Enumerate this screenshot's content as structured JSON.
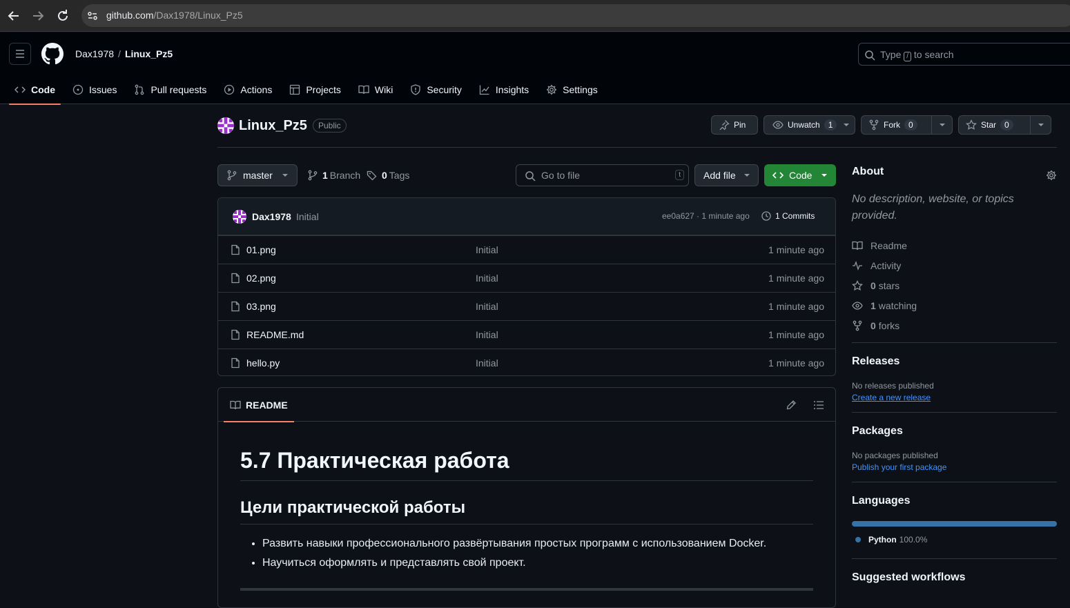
{
  "browser": {
    "url_host": "github.com",
    "url_path": "/Dax1978/Linux_Pz5"
  },
  "header": {
    "owner": "Dax1978",
    "separator": "/",
    "repo": "Linux_Pz5",
    "search_prefix": "Type",
    "search_key": "/",
    "search_suffix": "to search"
  },
  "tabs": [
    {
      "label": "Code",
      "icon": "code-icon"
    },
    {
      "label": "Issues",
      "icon": "issue-icon"
    },
    {
      "label": "Pull requests",
      "icon": "pull-request-icon"
    },
    {
      "label": "Actions",
      "icon": "play-icon"
    },
    {
      "label": "Projects",
      "icon": "table-icon"
    },
    {
      "label": "Wiki",
      "icon": "book-icon"
    },
    {
      "label": "Security",
      "icon": "shield-icon"
    },
    {
      "label": "Insights",
      "icon": "graph-icon"
    },
    {
      "label": "Settings",
      "icon": "gear-icon"
    }
  ],
  "repo": {
    "name": "Linux_Pz5",
    "visibility": "Public",
    "pin": "Pin",
    "unwatch": "Unwatch",
    "watch_count": "1",
    "fork": "Fork",
    "fork_count": "0",
    "star": "Star",
    "star_count": "0"
  },
  "toolbar": {
    "branch": "master",
    "branch_count": "1",
    "branch_label": "Branch",
    "tag_count": "0",
    "tag_label": "Tags",
    "go_to_file": "Go to file",
    "go_key": "t",
    "add_file": "Add file",
    "code": "Code"
  },
  "commit": {
    "author": "Dax1978",
    "message": "Initial",
    "hash_time": "ee0a627 · 1 minute ago",
    "commits": "1 Commits"
  },
  "files": [
    {
      "name": "01.png",
      "message": "Initial",
      "time": "1 minute ago"
    },
    {
      "name": "02.png",
      "message": "Initial",
      "time": "1 minute ago"
    },
    {
      "name": "03.png",
      "message": "Initial",
      "time": "1 minute ago"
    },
    {
      "name": "README.md",
      "message": "Initial",
      "time": "1 minute ago"
    },
    {
      "name": "hello.py",
      "message": "Initial",
      "time": "1 minute ago"
    }
  ],
  "readme": {
    "tab": "README",
    "h1": "5.7 Практическая работа",
    "h2": "Цели практической работы",
    "items": [
      "Развить навыки профессионального развёртывания простых программ с использованием Docker.",
      "Научиться оформлять и представлять свой проект."
    ]
  },
  "about": {
    "title": "About",
    "description": "No description, website, or topics provided.",
    "readme": "Readme",
    "activity": "Activity",
    "stars_count": "0",
    "stars_label": "stars",
    "watching_count": "1",
    "watching_label": "watching",
    "forks_count": "0",
    "forks_label": "forks"
  },
  "releases": {
    "title": "Releases",
    "empty": "No releases published",
    "link": "Create a new release"
  },
  "packages": {
    "title": "Packages",
    "empty": "No packages published",
    "link": "Publish your first package"
  },
  "languages": {
    "title": "Languages",
    "name": "Python",
    "percent": "100.0%",
    "color": "#3572a5"
  },
  "suggested": {
    "title": "Suggested workflows"
  }
}
